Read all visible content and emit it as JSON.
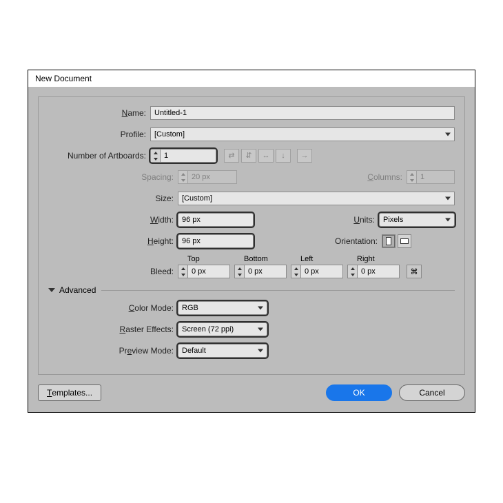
{
  "window": {
    "title": "New Document"
  },
  "fields": {
    "name_label": "Name:",
    "name_value": "Untitled-1",
    "profile_label": "Profile:",
    "profile_value": "[Custom]",
    "artboards_label": "Number of Artboards:",
    "artboards_value": "1",
    "spacing_label": "Spacing:",
    "spacing_value": "20 px",
    "columns_label": "Columns:",
    "columns_value": "1",
    "size_label": "Size:",
    "size_value": "[Custom]",
    "width_label": "Width:",
    "width_value": "96 px",
    "height_label": "Height:",
    "height_value": "96 px",
    "units_label": "Units:",
    "units_value": "Pixels",
    "orientation_label": "Orientation:",
    "bleed_label": "Bleed:",
    "bleed_top": "Top",
    "bleed_bottom": "Bottom",
    "bleed_left": "Left",
    "bleed_right": "Right",
    "bleed_value": "0 px"
  },
  "advanced": {
    "header": "Advanced",
    "color_mode_label": "Color Mode:",
    "color_mode_value": "RGB",
    "raster_label": "Raster Effects:",
    "raster_value": "Screen (72 ppi)",
    "preview_label": "Preview Mode:",
    "preview_value": "Default"
  },
  "buttons": {
    "templates": "Templates...",
    "ok": "OK",
    "cancel": "Cancel"
  },
  "underlines": {
    "N": "N",
    "ame": "ame:",
    "W": "W",
    "idth": "idth:",
    "H": "H",
    "eight": "eight:",
    "U": "U",
    "nits": "nits:",
    "C": "C",
    "olor_mode": "olor Mode:",
    "R": "R",
    "aster": "aster Effects:",
    "P_r": "Pr",
    "e": "e",
    "view_mode": "view Mode:",
    "C2": "C",
    "olumns": "olumns:",
    "T": "T",
    "emplates": "emplates..."
  }
}
